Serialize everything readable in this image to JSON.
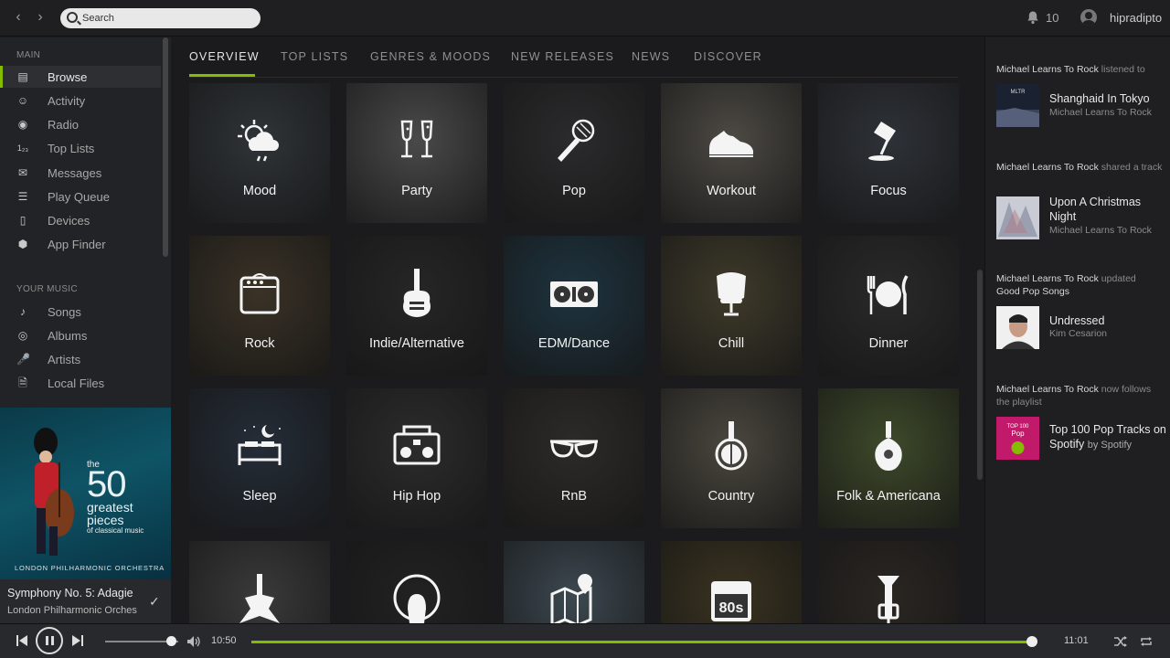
{
  "topbar": {
    "search_placeholder": "Search",
    "notifications_count": "10",
    "username": "hipradipto"
  },
  "sidebar": {
    "main_label": "MAIN",
    "main_items": [
      {
        "label": "Browse",
        "icon": "browse-icon",
        "active": true
      },
      {
        "label": "Activity",
        "icon": "activity-icon"
      },
      {
        "label": "Radio",
        "icon": "radio-icon"
      },
      {
        "label": "Top Lists",
        "icon": "top-lists-icon"
      },
      {
        "label": "Messages",
        "icon": "messages-icon"
      },
      {
        "label": "Play Queue",
        "icon": "play-queue-icon"
      },
      {
        "label": "Devices",
        "icon": "devices-icon"
      },
      {
        "label": "App Finder",
        "icon": "app-finder-icon"
      }
    ],
    "music_label": "YOUR MUSIC",
    "music_items": [
      {
        "label": "Songs",
        "icon": "songs-icon"
      },
      {
        "label": "Albums",
        "icon": "albums-icon"
      },
      {
        "label": "Artists",
        "icon": "artists-icon"
      },
      {
        "label": "Local Files",
        "icon": "local-files-icon"
      }
    ]
  },
  "album_art": {
    "line1": "the",
    "line2": "50",
    "line3": "greatest",
    "line4": "pieces",
    "line5": "of classical music",
    "orchestra": "LONDON PHILHARMONIC ORCHESTRA"
  },
  "now_playing": {
    "title": "Symphony No. 5: Adagie",
    "artist": "London Philharmonic Orches"
  },
  "tabs": [
    {
      "label": "OVERVIEW",
      "active": true
    },
    {
      "label": "TOP LISTS"
    },
    {
      "label": "GENRES & MOODS"
    },
    {
      "label": "NEW RELEASES"
    },
    {
      "label": "NEWS"
    },
    {
      "label": "DISCOVER"
    }
  ],
  "tiles": [
    {
      "label": "Mood",
      "icon": "weather-icon",
      "color": "#2f3438"
    },
    {
      "label": "Party",
      "icon": "champagne-icon",
      "color": "#4a4a4a"
    },
    {
      "label": "Pop",
      "icon": "microphone-icon",
      "color": "#2b2b2d"
    },
    {
      "label": "Workout",
      "icon": "sneaker-icon",
      "color": "#4d4a44"
    },
    {
      "label": "Focus",
      "icon": "desk-lamp-icon",
      "color": "#2e3238"
    },
    {
      "label": "Rock",
      "icon": "amplifier-icon",
      "color": "#3a3226"
    },
    {
      "label": "Indie/Alternative",
      "icon": "electric-guitar-icon",
      "color": "#262626"
    },
    {
      "label": "EDM/Dance",
      "icon": "turntables-icon",
      "color": "#1e3440"
    },
    {
      "label": "Chill",
      "icon": "egg-chair-icon",
      "color": "#3f3a2a"
    },
    {
      "label": "Dinner",
      "icon": "plate-cutlery-icon",
      "color": "#2a2a2a"
    },
    {
      "label": "Sleep",
      "icon": "bed-moon-icon",
      "color": "#252d38"
    },
    {
      "label": "Hip Hop",
      "icon": "boombox-icon",
      "color": "#2c2c2c"
    },
    {
      "label": "RnB",
      "icon": "sunglasses-icon",
      "color": "#2d2b29"
    },
    {
      "label": "Country",
      "icon": "banjo-icon",
      "color": "#4a473e"
    },
    {
      "label": "Folk & Americana",
      "icon": "mandolin-icon",
      "color": "#3e4a2a"
    },
    {
      "label": "",
      "icon": "metal-guitar-icon",
      "color": "#3a3a3a"
    },
    {
      "label": "",
      "icon": "afro-icon",
      "color": "#222222"
    },
    {
      "label": "",
      "icon": "map-pin-icon",
      "color": "#3c4850"
    },
    {
      "label": "",
      "icon": "calendar-80s-icon",
      "color": "#3a3320"
    },
    {
      "label": "",
      "icon": "trumpet-icon",
      "color": "#2a2622"
    }
  ],
  "feed": [
    {
      "actor": "Michael Learns To Rock",
      "action": "listened to",
      "track": "Shanghaid In Tokyo",
      "by": "",
      "sub": "Michael Learns To Rock"
    },
    {
      "actor": "Michael Learns To Rock",
      "action": "shared a track",
      "track": "Upon A Christmas Night",
      "by": "",
      "sub": "Michael Learns To Rock"
    },
    {
      "actor": "Michael Learns To Rock",
      "action": "updated",
      "playlist": "Good Pop Songs",
      "track": "Undressed",
      "by": "",
      "sub": "Kim Cesarion"
    },
    {
      "actor": "Michael Learns To Rock",
      "action": "now follows the playlist",
      "track": "Top 100 Pop Tracks on Spotify",
      "by": "by Spotify",
      "sub": ""
    }
  ],
  "feed_thumb_text": {
    "mltr": "MLTR",
    "top100_line1": "TOP 100",
    "top100_line2": "Pop"
  },
  "player": {
    "current_time": "10:50",
    "total_time": "11:01",
    "progress": 0.993,
    "volume": 0.9
  },
  "colors": {
    "accent": "#84bd00"
  }
}
